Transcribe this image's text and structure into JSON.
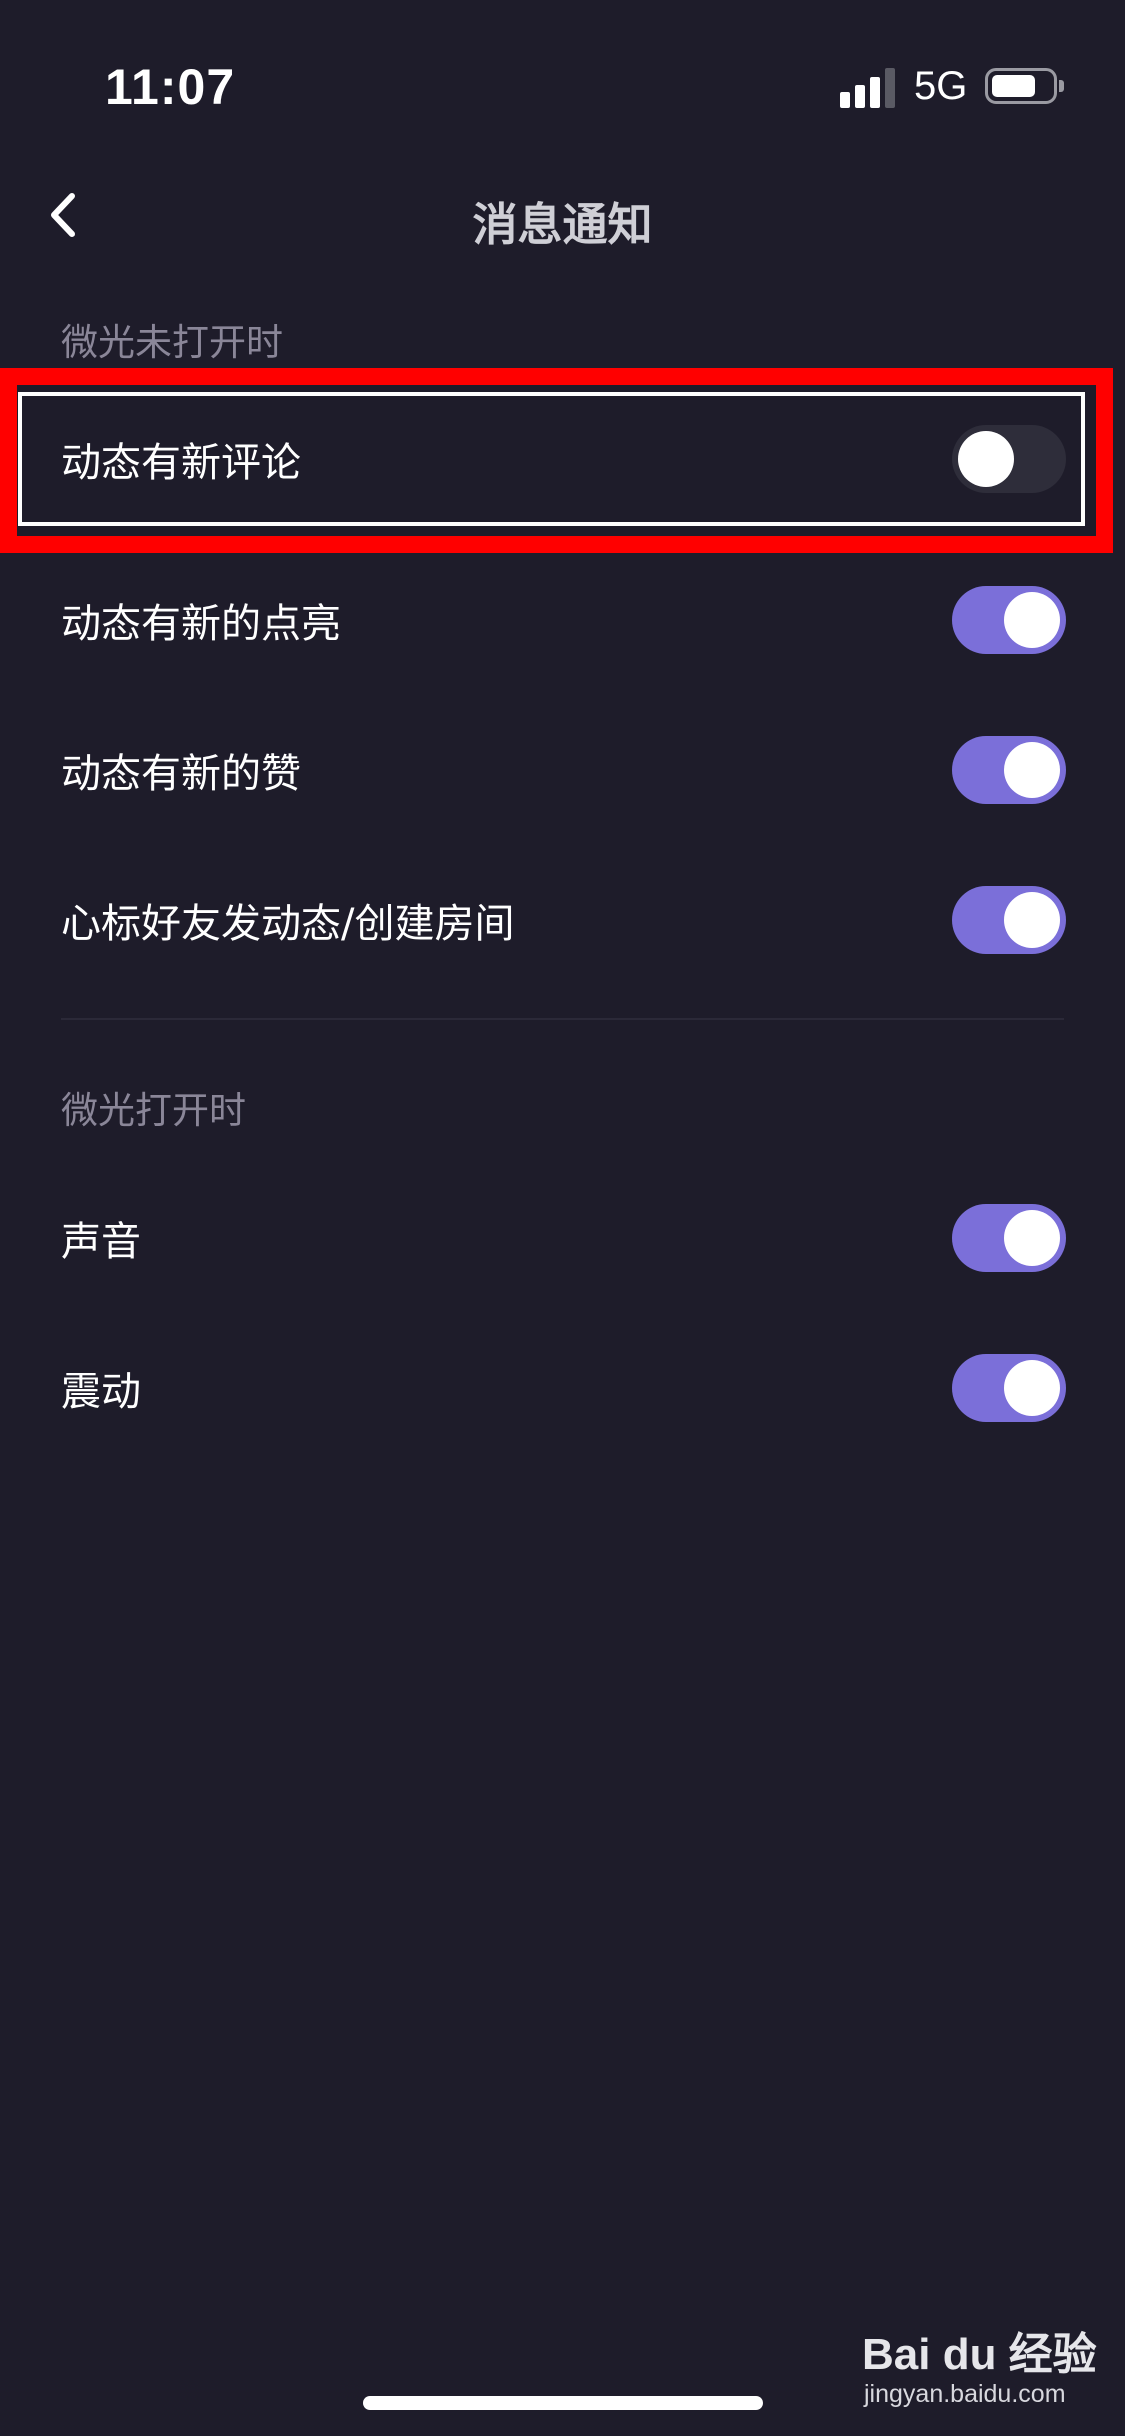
{
  "status_bar": {
    "time": "11:07",
    "network": "5G",
    "signal_bars_filled": 3,
    "signal_bars_total": 4
  },
  "nav": {
    "back_icon": "chevron-left-icon",
    "title": "消息通知"
  },
  "sections": [
    {
      "label": "微光未打开时",
      "items": [
        {
          "label": "动态有新评论",
          "enabled": false
        },
        {
          "label": "动态有新的点亮",
          "enabled": true
        },
        {
          "label": "动态有新的赞",
          "enabled": true
        },
        {
          "label": "心标好友发动态/创建房间",
          "enabled": true
        }
      ]
    },
    {
      "label": "微光打开时",
      "items": [
        {
          "label": "声音",
          "enabled": true
        },
        {
          "label": "震动",
          "enabled": true
        }
      ]
    }
  ],
  "watermark": {
    "brand": "Bai du 经验",
    "url": "jingyan.baidu.com"
  },
  "colors": {
    "background": "#1e1c2a",
    "toggle_on": "#7b6fd9",
    "toggle_off": "#2e2d3a",
    "highlight": "#ff0000",
    "section_label": "#8a8698"
  }
}
